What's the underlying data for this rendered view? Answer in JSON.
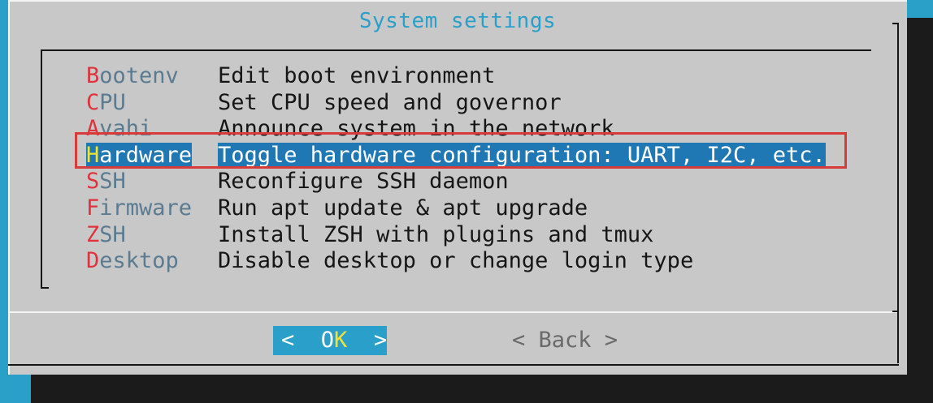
{
  "dialog": {
    "title": "System settings"
  },
  "menu": {
    "items": [
      {
        "hot": "B",
        "rest": "ootenv",
        "desc": "Edit boot environment"
      },
      {
        "hot": "C",
        "rest": "PU",
        "desc": "Set CPU speed and governor"
      },
      {
        "hot": "A",
        "rest": "vahi",
        "desc": "Announce system in the network"
      },
      {
        "hot": "H",
        "rest": "ardware",
        "desc": "Toggle hardware configuration: UART, I2C, etc."
      },
      {
        "hot": "S",
        "rest": "SH",
        "desc": "Reconfigure SSH daemon"
      },
      {
        "hot": "F",
        "rest": "irmware",
        "desc": "Run apt update & apt upgrade"
      },
      {
        "hot": "Z",
        "rest": "SH",
        "desc": "Install ZSH with plugins and tmux"
      },
      {
        "hot": "D",
        "rest": "esktop",
        "desc": "Disable desktop or change login type"
      }
    ],
    "selected_index": 3
  },
  "buttons": {
    "ok": {
      "left": "<  ",
      "hot_pre": "O",
      "hot": "K",
      "right": "  >"
    },
    "back": {
      "label": "< Back >"
    }
  },
  "colors": {
    "terminal_background": "#2aa0c8",
    "dialog_background": "#c8c8c8",
    "hotkey": "#e0323a",
    "tag_text": "#5b7b92",
    "selection_background": "#1f78b4",
    "selection_hotkey": "#f2e234",
    "annotation_box": "#d83a3a"
  }
}
